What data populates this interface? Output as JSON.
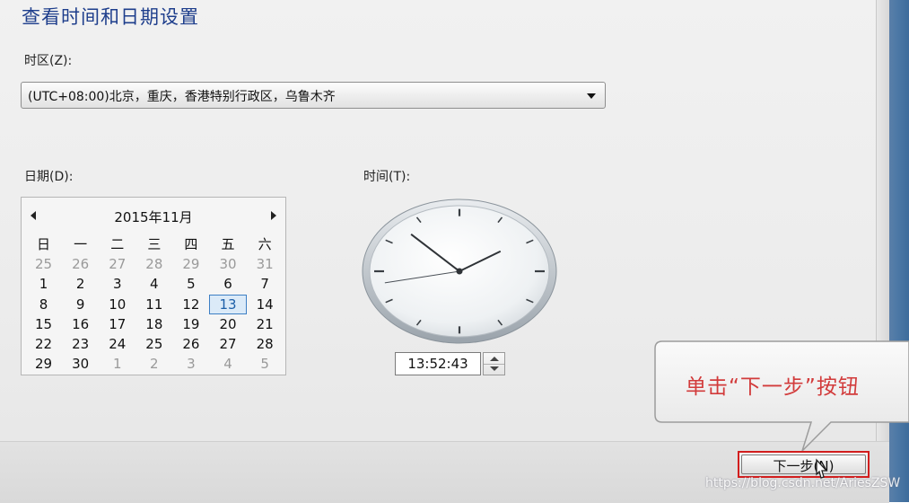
{
  "page_title": "查看时间和日期设置",
  "timezone": {
    "label": "时区(Z):",
    "selected": "(UTC+08:00)北京，重庆，香港特别行政区，乌鲁木齐"
  },
  "date": {
    "label": "日期(D):",
    "month_title": "2015年11月",
    "weekdays": [
      "日",
      "一",
      "二",
      "三",
      "四",
      "五",
      "六"
    ],
    "weeks": [
      [
        "25",
        "26",
        "27",
        "28",
        "29",
        "30",
        "31"
      ],
      [
        "1",
        "2",
        "3",
        "4",
        "5",
        "6",
        "7"
      ],
      [
        "8",
        "9",
        "10",
        "11",
        "12",
        "13",
        "14"
      ],
      [
        "15",
        "16",
        "17",
        "18",
        "19",
        "20",
        "21"
      ],
      [
        "22",
        "23",
        "24",
        "25",
        "26",
        "27",
        "28"
      ],
      [
        "29",
        "30",
        "1",
        "2",
        "3",
        "4",
        "5"
      ]
    ],
    "selected_day": "13"
  },
  "time": {
    "label": "时间(T):",
    "value": "13:52:43",
    "hour": 13,
    "minute": 52,
    "second": 43
  },
  "next_button": {
    "label": "下一步(N)"
  },
  "callout": {
    "text": "单击“下一步”按钮",
    "color": "#d23b3b"
  },
  "watermark": "https://blog.csdn.net/AriesZSW",
  "colors": {
    "title": "#1e3e8c",
    "highlight_border": "#d21d1d"
  }
}
